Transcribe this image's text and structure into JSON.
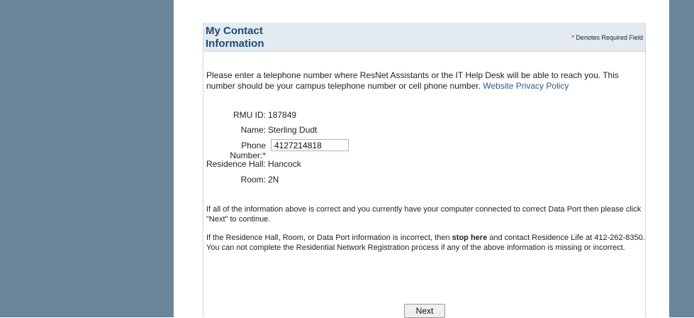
{
  "header": {
    "title": "My Contact Information",
    "required_note": "Denotes Required Field",
    "required_star": "*"
  },
  "intro": {
    "text": "Please enter a telephone number where ResNet Assistants or the IT Help Desk will be able to reach you. This number should be your campus telephone number or cell phone number.",
    "privacy_link": "Website Privacy Policy"
  },
  "fields": {
    "rmu_id": {
      "label": "RMU ID:",
      "value": "187849"
    },
    "name": {
      "label": "Name:",
      "value": "Sterling Dudt"
    },
    "phone": {
      "label": "Phone Number:",
      "required_star": "*",
      "value": "4127214818"
    },
    "residence_hall": {
      "label": "Residence Hall:",
      "value": "Hancock"
    },
    "room": {
      "label": "Room:",
      "value": "2N"
    }
  },
  "messages": {
    "confirm": "If all of the information above is correct and you currently have your computer connected to correct Data Port then please click \"Next\" to continue.",
    "incorrect_pre": "If the Residence Hall, Room, or Data Port information is incorrect, then",
    "incorrect_bold": "stop here",
    "incorrect_post": "and contact Residence Life at 412-262-8350. You can not complete the Residential Network Registration process if any of the above information is missing or incorrect."
  },
  "buttons": {
    "next": "Next"
  },
  "colors": {
    "side_panel": "#6a8599",
    "header_bg": "#e3eaf0",
    "title": "#1f4a73",
    "required": "#cc0000",
    "link": "#2a5a8c"
  }
}
